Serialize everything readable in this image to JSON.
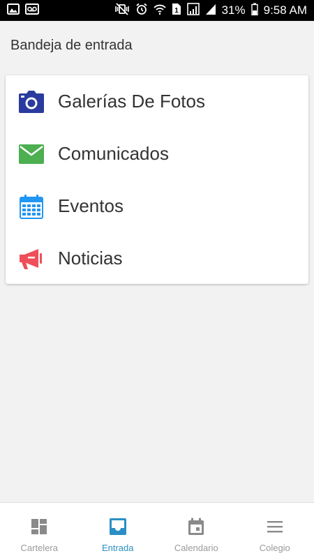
{
  "status_bar": {
    "battery": "31%",
    "time": "9:58 AM",
    "sim_badge": "1",
    "icons_left": [
      "image-notification-icon",
      "voicemail-icon"
    ],
    "icons_right": [
      "mute-vibrate-icon",
      "alarm-icon",
      "wifi-icon",
      "sim-icon",
      "signal-icon",
      "signal-2-icon",
      "battery-icon"
    ]
  },
  "header": {
    "title": "Bandeja de entrada"
  },
  "menu": {
    "items": [
      {
        "label": "Galerías De Fotos",
        "icon": "camera-icon",
        "color": "#2a3a9e"
      },
      {
        "label": "Comunicados",
        "icon": "envelope-icon",
        "color": "#4caf50"
      },
      {
        "label": "Eventos",
        "icon": "calendar-icon",
        "color": "#2196f3"
      },
      {
        "label": "Noticias",
        "icon": "megaphone-icon",
        "color": "#ef4f5a"
      }
    ]
  },
  "bottom_nav": {
    "active": "Entrada",
    "active_color": "#2a8fc4",
    "inactive_color": "#8a8a8a",
    "items": [
      {
        "label": "Cartelera",
        "icon": "dashboard-icon"
      },
      {
        "label": "Entrada",
        "icon": "inbox-icon"
      },
      {
        "label": "Calendario",
        "icon": "calendar-day-icon"
      },
      {
        "label": "Colegio",
        "icon": "menu-icon"
      }
    ]
  }
}
